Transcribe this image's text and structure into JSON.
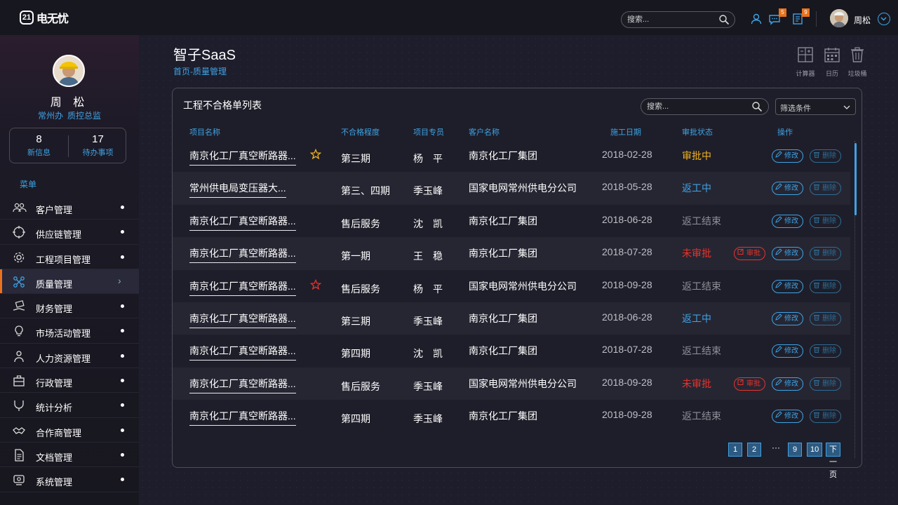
{
  "app": {
    "logo_badge": "21",
    "logo_text": "电无忧"
  },
  "topbar": {
    "search_placeholder": "搜索...",
    "message_badge": "5",
    "notice_badge": "9",
    "user_name": "周松"
  },
  "sidebar": {
    "name": "周 松",
    "dept": "常州办",
    "title": "质控总监",
    "stats": [
      {
        "value": "8",
        "label": "新信息"
      },
      {
        "value": "17",
        "label": "待办事项"
      }
    ],
    "menu_title": "菜单",
    "items": [
      {
        "label": "客户管理",
        "icon": "users-icon"
      },
      {
        "label": "供应链管理",
        "icon": "crosshair-icon"
      },
      {
        "label": "工程项目管理",
        "icon": "gear-icon"
      },
      {
        "label": "质量管理",
        "icon": "nodes-icon",
        "active": true
      },
      {
        "label": "财务管理",
        "icon": "money-hand-icon"
      },
      {
        "label": "市场活动管理",
        "icon": "bulb-icon"
      },
      {
        "label": "人力资源管理",
        "icon": "person-icon"
      },
      {
        "label": "行政管理",
        "icon": "briefcase-icon"
      },
      {
        "label": "统计分析",
        "icon": "fork-icon"
      },
      {
        "label": "合作商管理",
        "icon": "handshake-icon"
      },
      {
        "label": "文档管理",
        "icon": "document-icon"
      },
      {
        "label": "系统管理",
        "icon": "system-icon"
      }
    ]
  },
  "page": {
    "title": "智子SaaS",
    "breadcrumb": "首页-质量管理",
    "tools": [
      {
        "label": "计算器",
        "icon": "calculator-icon"
      },
      {
        "label": "日历",
        "icon": "calendar-icon"
      },
      {
        "label": "垃圾桶",
        "icon": "trash-icon"
      }
    ]
  },
  "table": {
    "title": "工程不合格单列表",
    "search_placeholder": "搜索...",
    "filter_label": "筛选条件",
    "headers": [
      "项目名称",
      "不合格程度",
      "项目专员",
      "客户名称",
      "施工日期",
      "审批状态",
      "操作"
    ],
    "edit_label": "修改",
    "delete_label": "删除",
    "audit_label": "审批",
    "rows": [
      {
        "project": "南京化工厂真空断路器...",
        "level": "第三期",
        "staff": "杨　平",
        "client": "南京化工厂集团",
        "date": "2018-02-28",
        "status": "审批中",
        "status_color": "yellow",
        "star": "gold",
        "audit": false
      },
      {
        "project": "常州供电局变压器大...",
        "level": "第三、四期",
        "staff": "季玉峰",
        "client": "国家电网常州供电分公司",
        "date": "2018-05-28",
        "status": "返工中",
        "status_color": "blue",
        "star": "",
        "audit": false
      },
      {
        "project": "南京化工厂真空断路器...",
        "level": "售后服务",
        "staff": "沈　凯",
        "client": "南京化工厂集团",
        "date": "2018-06-28",
        "status": "返工结束",
        "status_color": "gray",
        "star": "",
        "audit": false
      },
      {
        "project": "南京化工厂真空断路器...",
        "level": "第一期",
        "staff": "王　稳",
        "client": "南京化工厂集团",
        "date": "2018-07-28",
        "status": "未审批",
        "status_color": "red",
        "star": "",
        "audit": true
      },
      {
        "project": "南京化工厂真空断路器...",
        "level": "售后服务",
        "staff": "杨　平",
        "client": "国家电网常州供电分公司",
        "date": "2018-09-28",
        "status": "返工结束",
        "status_color": "gray",
        "star": "red",
        "audit": false
      },
      {
        "project": "南京化工厂真空断路器...",
        "level": "第三期",
        "staff": "季玉峰",
        "client": "南京化工厂集团",
        "date": "2018-06-28",
        "status": "返工中",
        "status_color": "blue",
        "star": "",
        "audit": false
      },
      {
        "project": "南京化工厂真空断路器...",
        "level": "第四期",
        "staff": "沈　凯",
        "client": "南京化工厂集团",
        "date": "2018-07-28",
        "status": "返工结束",
        "status_color": "gray",
        "star": "",
        "audit": false
      },
      {
        "project": "南京化工厂真空断路器...",
        "level": "售后服务",
        "staff": "季玉峰",
        "client": "国家电网常州供电分公司",
        "date": "2018-09-28",
        "status": "未审批",
        "status_color": "red",
        "star": "",
        "audit": true
      },
      {
        "project": "南京化工厂真空断路器...",
        "level": "第四期",
        "staff": "季玉峰",
        "client": "南京化工厂集团",
        "date": "2018-09-28",
        "status": "返工结束",
        "status_color": "gray",
        "star": "",
        "audit": false
      }
    ]
  },
  "pagination": {
    "pages": [
      "1",
      "2"
    ],
    "ellipsis": "···",
    "tail_pages": [
      "9",
      "10"
    ],
    "next_label": "下一页"
  },
  "colors": {
    "accent": "#3ea3e5",
    "warning": "#f2b21f",
    "danger": "#e8322b",
    "badge": "#e8721d"
  }
}
